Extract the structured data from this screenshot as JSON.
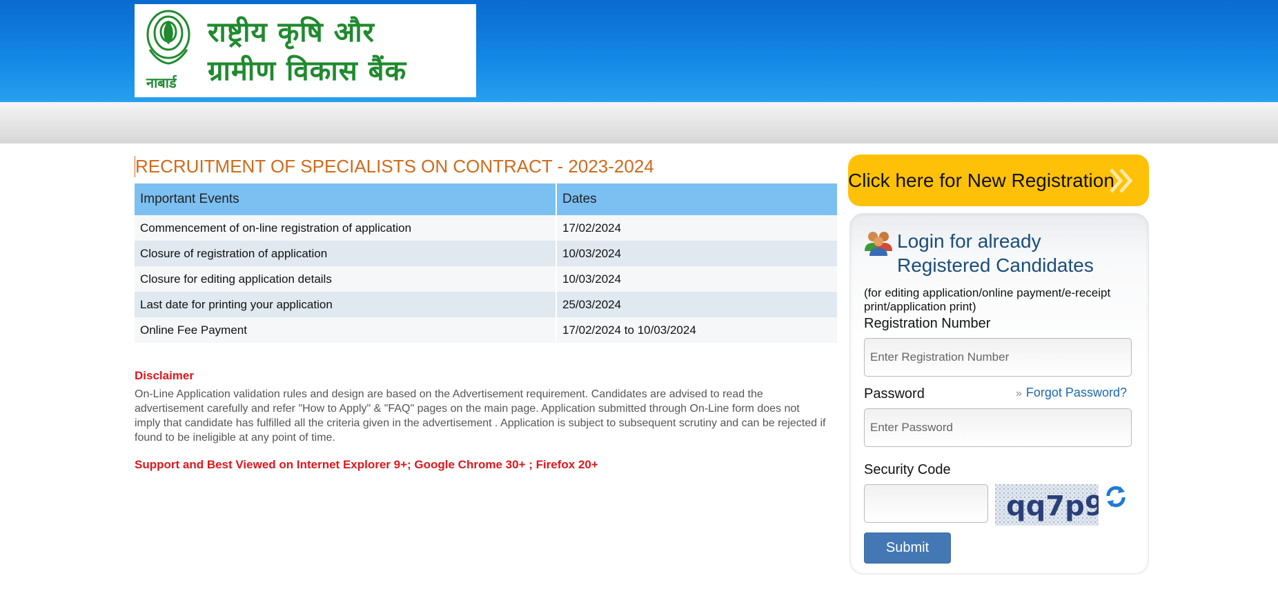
{
  "header": {
    "logo_line1": "राष्ट्रीय कृषि और",
    "logo_line2": "ग्रामीण विकास बैंक",
    "logo_short": "नाबार्ड"
  },
  "page_title": "RECRUITMENT OF SPECIALISTS ON CONTRACT - 2023-2024",
  "events_table": {
    "headers": [
      "Important Events",
      "Dates"
    ],
    "rows": [
      [
        "Commencement of on-line registration of application",
        "17/02/2024"
      ],
      [
        "Closure of registration of application",
        "10/03/2024"
      ],
      [
        "Closure for editing application details",
        "10/03/2024"
      ],
      [
        "Last date for printing your application",
        "25/03/2024"
      ],
      [
        "Online Fee Payment",
        "17/02/2024 to 10/03/2024"
      ]
    ]
  },
  "disclaimer": {
    "title": "Disclaimer",
    "text": "On-Line Application validation rules and design are based on the Advertisement requirement. Candidates are advised to read the advertisement carefully and refer \"How to Apply\" & \"FAQ\" pages on the main page. Application submitted through On-Line form does not imply that candidate has fulfilled all the criteria given in the advertisement . Application is subject to subsequent scrutiny and can be rejected if found to be ineligible at any point of time."
  },
  "support_note": "Support and Best Viewed on Internet Explorer 9+; Google Chrome 30+ ; Firefox 20+",
  "new_registration": {
    "label": "Click here for New Registration",
    "icon": "double-chevron-right-icon"
  },
  "login": {
    "icon": "users-icon",
    "title_line1": "Login for already",
    "title_line2": "Registered Candidates",
    "subtitle": "(for editing application/online payment/e-receipt print/application print)",
    "registration_label": "Registration Number",
    "registration_placeholder": "Enter Registration Number",
    "registration_value": "",
    "password_label": "Password",
    "password_placeholder": "Enter Password",
    "password_value": "",
    "forgot_password": "Forgot Password?",
    "security_code_label": "Security Code",
    "security_code_value": "",
    "captcha_text": "qq7p9",
    "submit_label": "Submit"
  },
  "colors": {
    "header_blue": "#0a6ad0",
    "title_orange": "#d06a1a",
    "table_header": "#7cc0f2",
    "alert_red": "#e0161b",
    "register_yellow": "#ffc107",
    "submit_blue": "#4478b5",
    "logo_green": "#1f8a2e"
  }
}
